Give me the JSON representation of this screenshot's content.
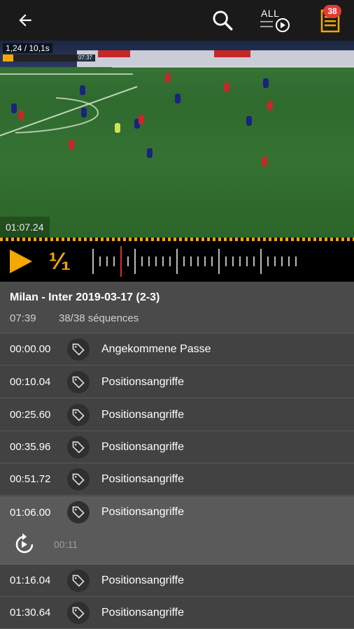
{
  "topbar": {
    "back_icon": "arrow-left-icon",
    "search_icon": "search-icon",
    "all_label": "ALL",
    "playlist_icon": "list-icon",
    "badge_count": "38",
    "accent_color": "#f5a800",
    "badge_color": "#e53935"
  },
  "video": {
    "scoreboard": "1,24 / 10,1s",
    "clock": "07:37",
    "progress": 0.11,
    "timestamp": "01:07.24"
  },
  "controls": {
    "play_icon": "play-icon",
    "speed_label": "¹⁄₁"
  },
  "match": {
    "title": "Milan - Inter 2019-03-17 (2-3)",
    "duration": "07:39",
    "sequences": "38/38 séquences"
  },
  "rows": [
    {
      "time": "00:00.00",
      "label": "Angekommene Passe"
    },
    {
      "time": "00:10.04",
      "label": "Positionsangriffe"
    },
    {
      "time": "00:25.60",
      "label": "Positionsangriffe"
    },
    {
      "time": "00:35.96",
      "label": "Positionsangriffe"
    },
    {
      "time": "00:51.72",
      "label": "Positionsangriffe"
    },
    {
      "time": "01:06.00",
      "label": "Positionsangriffe"
    },
    {
      "time": "01:16.04",
      "label": "Positionsangriffe"
    },
    {
      "time": "01:30.64",
      "label": "Positionsangriffe"
    }
  ],
  "expanded": {
    "replay_icon": "replay-icon",
    "duration": "00:11"
  }
}
